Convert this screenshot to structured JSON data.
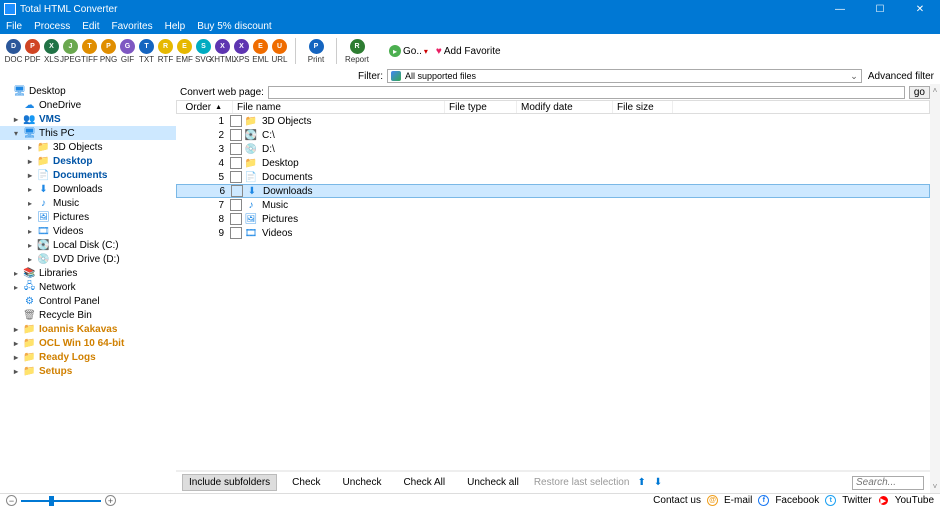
{
  "title": "Total HTML Converter",
  "menu": [
    "File",
    "Process",
    "Edit",
    "Favorites",
    "Help",
    "Buy 5% discount"
  ],
  "formats": [
    {
      "label": "DOC",
      "color": "#2b579a"
    },
    {
      "label": "PDF",
      "color": "#d04423"
    },
    {
      "label": "XLS",
      "color": "#217346"
    },
    {
      "label": "JPEG",
      "color": "#6aa84f"
    },
    {
      "label": "TIFF",
      "color": "#e08e00"
    },
    {
      "label": "PNG",
      "color": "#e08e00"
    },
    {
      "label": "GIF",
      "color": "#7e57c2"
    },
    {
      "label": "TXT",
      "color": "#1565c0"
    },
    {
      "label": "RTF",
      "color": "#e6b800"
    },
    {
      "label": "EMF",
      "color": "#e6b800"
    },
    {
      "label": "SVG",
      "color": "#00acc1"
    },
    {
      "label": "XHTML",
      "color": "#5e35b1"
    },
    {
      "label": "XPS",
      "color": "#5e35b1"
    },
    {
      "label": "EML",
      "color": "#ef6c00"
    },
    {
      "label": "URL",
      "color": "#ef6c00"
    }
  ],
  "actions": {
    "print": "Print",
    "print_color": "#1565c0",
    "report": "Report",
    "report_color": "#2e7d32",
    "go": "Go..",
    "addfav": "Add Favorite"
  },
  "filter": {
    "label": "Filter:",
    "value": "All supported files",
    "advanced": "Advanced filter"
  },
  "convert": {
    "label": "Convert web page:",
    "go": "go"
  },
  "columns": {
    "order": "Order",
    "name": "File name",
    "type": "File type",
    "date": "Modify date",
    "size": "File size"
  },
  "tree": [
    {
      "ind": 0,
      "arrow": "",
      "icon": "🖥",
      "cls": "fi-blue",
      "label": "Desktop"
    },
    {
      "ind": 1,
      "arrow": "",
      "icon": "☁",
      "cls": "fi-blue",
      "label": "OneDrive"
    },
    {
      "ind": 1,
      "arrow": "▸",
      "icon": "👥",
      "cls": "fi-blue",
      "label": "VMS",
      "bold": true
    },
    {
      "ind": 1,
      "arrow": "▾",
      "icon": "🖥",
      "cls": "fi-pc",
      "label": "This PC",
      "sel": true
    },
    {
      "ind": 2,
      "arrow": "▸",
      "icon": "📁",
      "cls": "fi-blue",
      "label": "3D Objects"
    },
    {
      "ind": 2,
      "arrow": "▸",
      "icon": "📁",
      "cls": "fi-blue",
      "label": "Desktop",
      "bold": true
    },
    {
      "ind": 2,
      "arrow": "▸",
      "icon": "📄",
      "cls": "fi-blue",
      "label": "Documents",
      "bold": true
    },
    {
      "ind": 2,
      "arrow": "▸",
      "icon": "⬇",
      "cls": "fi-blue",
      "label": "Downloads"
    },
    {
      "ind": 2,
      "arrow": "▸",
      "icon": "♪",
      "cls": "fi-blue",
      "label": "Music"
    },
    {
      "ind": 2,
      "arrow": "▸",
      "icon": "🖼",
      "cls": "fi-blue",
      "label": "Pictures"
    },
    {
      "ind": 2,
      "arrow": "▸",
      "icon": "🎞",
      "cls": "fi-blue",
      "label": "Videos"
    },
    {
      "ind": 2,
      "arrow": "▸",
      "icon": "💽",
      "cls": "fi-drive",
      "label": "Local Disk (C:)"
    },
    {
      "ind": 2,
      "arrow": "▸",
      "icon": "💿",
      "cls": "fi-drive",
      "label": "DVD Drive (D:)"
    },
    {
      "ind": 1,
      "arrow": "▸",
      "icon": "📚",
      "cls": "fi-blue",
      "label": "Libraries"
    },
    {
      "ind": 1,
      "arrow": "▸",
      "icon": "🖧",
      "cls": "fi-blue",
      "label": "Network"
    },
    {
      "ind": 1,
      "arrow": "",
      "icon": "⚙",
      "cls": "fi-blue",
      "label": "Control Panel"
    },
    {
      "ind": 1,
      "arrow": "",
      "icon": "🗑",
      "cls": "fi-gray",
      "label": "Recycle Bin"
    },
    {
      "ind": 1,
      "arrow": "▸",
      "icon": "📁",
      "cls": "fi-yellow",
      "label": "Ioannis Kakavas",
      "boldorange": true
    },
    {
      "ind": 1,
      "arrow": "▸",
      "icon": "📁",
      "cls": "fi-yellow",
      "label": "OCL Win 10 64-bit",
      "boldorange": true
    },
    {
      "ind": 1,
      "arrow": "▸",
      "icon": "📁",
      "cls": "fi-yellow",
      "label": "Ready Logs",
      "boldorange": true
    },
    {
      "ind": 1,
      "arrow": "▸",
      "icon": "📁",
      "cls": "fi-yellow",
      "label": "Setups",
      "boldorange": true
    }
  ],
  "files": [
    {
      "n": "1",
      "icon": "📁",
      "cls": "fi-blue",
      "name": "3D Objects"
    },
    {
      "n": "2",
      "icon": "💽",
      "cls": "fi-drive",
      "name": "C:\\"
    },
    {
      "n": "3",
      "icon": "💿",
      "cls": "fi-drive",
      "name": "D:\\"
    },
    {
      "n": "4",
      "icon": "📁",
      "cls": "fi-blue",
      "name": "Desktop"
    },
    {
      "n": "5",
      "icon": "📄",
      "cls": "fi-blue",
      "name": "Documents"
    },
    {
      "n": "6",
      "icon": "⬇",
      "cls": "fi-blue",
      "name": "Downloads",
      "sel": true
    },
    {
      "n": "7",
      "icon": "♪",
      "cls": "fi-blue",
      "name": "Music"
    },
    {
      "n": "8",
      "icon": "🖼",
      "cls": "fi-blue",
      "name": "Pictures"
    },
    {
      "n": "9",
      "icon": "🎞",
      "cls": "fi-blue",
      "name": "Videos"
    }
  ],
  "bottom": {
    "include": "Include subfolders",
    "check": "Check",
    "uncheck": "Uncheck",
    "checkall": "Check All",
    "uncheckall": "Uncheck all",
    "restore": "Restore last selection",
    "search": "Search..."
  },
  "status": {
    "contact": "Contact us",
    "email": "E-mail",
    "facebook": "Facebook",
    "twitter": "Twitter",
    "youtube": "YouTube"
  }
}
